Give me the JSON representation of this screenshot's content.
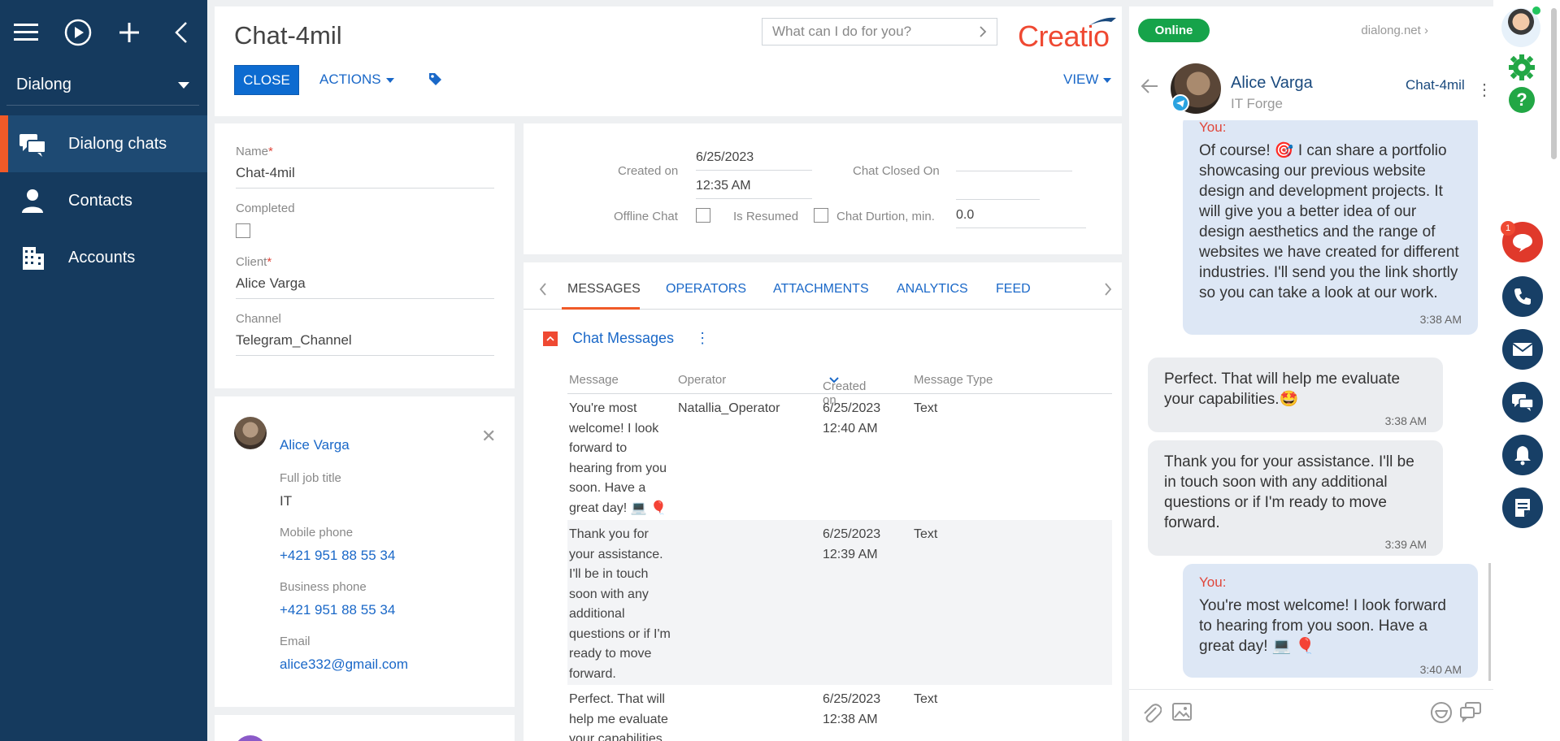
{
  "nav": {
    "workspace": "Dialong",
    "items": [
      {
        "label": "Dialong chats",
        "active": true
      },
      {
        "label": "Contacts",
        "active": false
      },
      {
        "label": "Accounts",
        "active": false
      }
    ]
  },
  "header": {
    "title": "Chat-4mil",
    "search_placeholder": "What can I do for you?",
    "logo": "Creatio",
    "close_label": "CLOSE",
    "actions_label": "ACTIONS",
    "view_label": "VIEW"
  },
  "fields": {
    "name_label": "Name",
    "name_value": "Chat-4mil",
    "completed_label": "Completed",
    "client_label": "Client",
    "client_value": "Alice Varga",
    "channel_label": "Channel",
    "channel_value": "Telegram_Channel",
    "required_mark": "*"
  },
  "contact_card": {
    "name": "Alice Varga",
    "job_label": "Full job title",
    "job_value": "IT",
    "mobile_label": "Mobile phone",
    "mobile_value": "+421 951 88 55 34",
    "business_label": "Business phone",
    "business_value": "+421 951 88 55 34",
    "email_label": "Email",
    "email_value": "alice332@gmail.com"
  },
  "details": {
    "created_on_label": "Created on",
    "created_date": "6/25/2023",
    "created_time": "12:35 AM",
    "closed_on_label": "Chat Closed On",
    "offline_label": "Offline Chat",
    "resumed_label": "Is Resumed",
    "duration_label": "Chat Durtion, min.",
    "duration_value": "0.0"
  },
  "tabs": [
    "MESSAGES",
    "OPERATORS",
    "ATTACHMENTS",
    "ANALYTICS",
    "FEED"
  ],
  "messages_detail": {
    "title": "Chat Messages",
    "columns": [
      "Message",
      "Operator",
      "Created on",
      "Message Type"
    ],
    "rows": [
      {
        "message_lines": [
          "You're most",
          "welcome! I look",
          "forward to",
          "hearing from you",
          "soon. Have a",
          "great day! 💻 🎈"
        ],
        "operator": "Natallia_Operator",
        "date": "6/25/2023",
        "time": "12:40 AM",
        "type": "Text"
      },
      {
        "message_lines": [
          "Thank you for",
          "your assistance.",
          "I'll be in touch",
          "soon with any",
          "additional",
          "questions or if I'm",
          "ready to move",
          "forward."
        ],
        "operator": "",
        "date": "6/25/2023",
        "time": "12:39 AM",
        "type": "Text"
      },
      {
        "message_lines": [
          "Perfect. That will",
          "help me evaluate",
          "your capabilities."
        ],
        "operator": "",
        "date": "6/25/2023",
        "time": "12:38 AM",
        "type": "Text"
      }
    ]
  },
  "chat": {
    "status": "Online",
    "domain": "dialong.net",
    "contact_name": "Alice Varga",
    "company": "IT Forge",
    "chat_ref": "Chat-4mil",
    "you_label": "You:",
    "bubbles": [
      {
        "dir": "out",
        "text": "Of course! 🎯 I can share a portfolio showcasing our previous website design and development projects. It will give you a better idea of our design aesthetics and the range of websites we have created for different industries. I'll send you the link shortly so you can take a look at our work.",
        "time": "3:38 AM"
      },
      {
        "dir": "in",
        "text": "Perfect. That will help me evaluate your capabilities.🤩",
        "time": "3:38 AM"
      },
      {
        "dir": "in",
        "text": "Thank you for your assistance. I'll be in touch soon with any additional questions or if I'm ready to move forward.",
        "time": "3:39 AM"
      },
      {
        "dir": "out",
        "text": "You're most welcome! I look forward to hearing from you soon. Have a great day! 💻 🎈",
        "time": "3:40 AM"
      }
    ]
  },
  "rail": {
    "unread_badge": "1"
  },
  "colors": {
    "nav_bg": "#153a5e",
    "accent_orange": "#f05a28",
    "primary_blue": "#0d6bd0",
    "link_blue": "#1a68c8",
    "online_green": "#16a34a"
  }
}
